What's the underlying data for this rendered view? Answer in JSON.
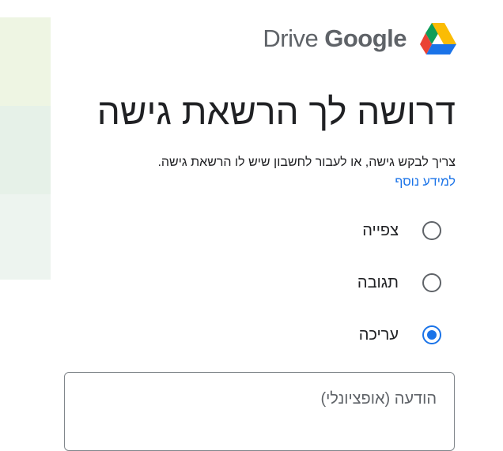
{
  "header": {
    "logo_word_1": "Drive",
    "logo_word_2": "Google",
    "icon": "google-drive-icon"
  },
  "title": "דרושה לך הרשאת גישה",
  "description": {
    "text": "צריך לבקש גישה, או לעבור לחשבון שיש לו הרשאת גישה.",
    "link": "למידע נוסף"
  },
  "access_options": [
    {
      "label": "צפייה",
      "selected": false
    },
    {
      "label": "תגובה",
      "selected": false
    },
    {
      "label": "עריכה",
      "selected": true
    }
  ],
  "message": {
    "placeholder": "הודעה (אופציונלי)",
    "value": ""
  },
  "colors": {
    "accent": "#1a73e8",
    "side_panel": [
      "#eef5e3",
      "#e6f1e8",
      "#edf4ef"
    ]
  }
}
